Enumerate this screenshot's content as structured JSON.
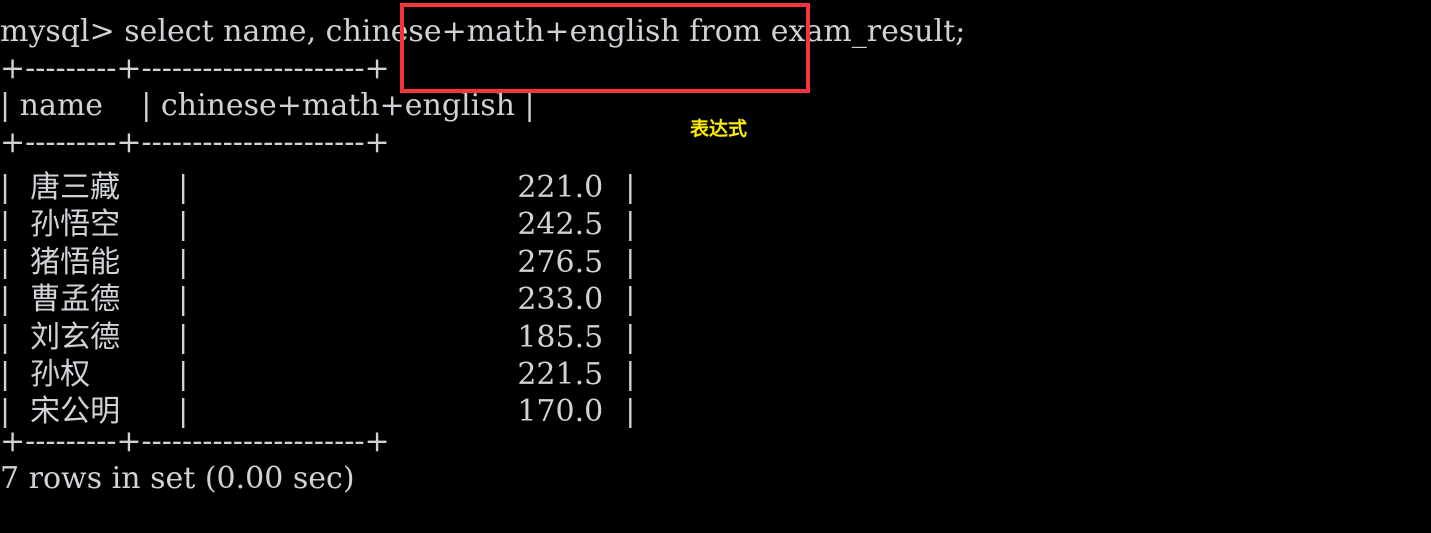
{
  "terminal": {
    "prompt": "mysql>",
    "query": "select name, chinese+math+english from exam_result;",
    "query_prefix": "mysql> select name, ",
    "query_highlight": "chinese+math+english",
    "query_suffix": " from exam_result;",
    "separator_top": "+---------+----------------------+",
    "separator_mid": "+---------+----------------------+",
    "separator_bottom": "+---------+----------------------+",
    "header_row": "| name    | chinese+math+english |",
    "status": "7 rows in set (0.00 sec)",
    "columns": [
      "name",
      "chinese+math+english"
    ],
    "rows": [
      {
        "name": "唐三藏",
        "total": "221.0"
      },
      {
        "name": "孙悟空",
        "total": "242.5"
      },
      {
        "name": "猪悟能",
        "total": "276.5"
      },
      {
        "name": "曹孟德",
        "total": "233.0"
      },
      {
        "name": "刘玄德",
        "total": "185.5"
      },
      {
        "name": "孙权",
        "total": "221.5"
      },
      {
        "name": "宋公明",
        "total": "170.0"
      }
    ]
  },
  "annotations": {
    "expression_label": "表达式",
    "highlight_color": "#f7333e",
    "label_color": "#ffec00"
  },
  "theme": {
    "background": "#000000",
    "foreground": "#c9ccd1"
  }
}
